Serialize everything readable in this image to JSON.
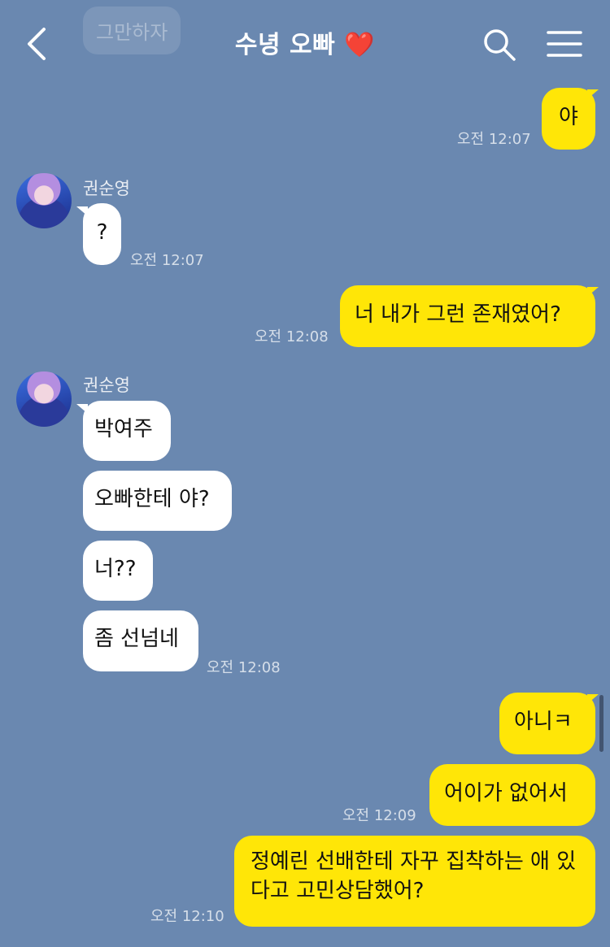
{
  "header": {
    "title": "수녕 오빠",
    "title_emoji": "❤️",
    "ghost_message": "그만하자"
  },
  "colors": {
    "background": "#6a88b0",
    "outgoing_bubble": "#ffe607",
    "incoming_bubble": "#ffffff",
    "heart": "#e0232f"
  },
  "messages": [
    {
      "side": "out",
      "text": "야",
      "time": "오전 12:07"
    },
    {
      "side": "in",
      "sender": "권순영",
      "text": "?",
      "time": "오전 12:07"
    },
    {
      "side": "out",
      "text": "너 내가 그런 존재였어?",
      "time": "오전 12:08"
    },
    {
      "side": "in",
      "sender": "권순영",
      "text": "박여주"
    },
    {
      "side": "in",
      "text": "오빠한테 야?"
    },
    {
      "side": "in",
      "text": "너??"
    },
    {
      "side": "in",
      "text": "좀 선넘네",
      "time": "오전 12:08"
    },
    {
      "side": "out",
      "text": "아니ㅋ"
    },
    {
      "side": "out",
      "text": "어이가 없어서",
      "time": "오전 12:09"
    },
    {
      "side": "out",
      "text": "정예린 선배한테 자꾸 집착하는 애 있다고 고민상담했어?",
      "time": "오전 12:10"
    }
  ],
  "icons": [
    "back-arrow-icon",
    "search-icon",
    "menu-icon"
  ]
}
